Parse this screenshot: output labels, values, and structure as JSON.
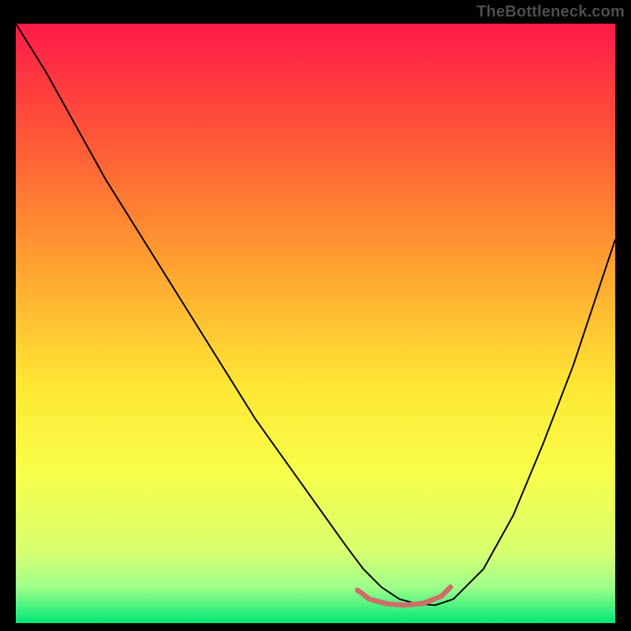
{
  "watermark": "TheBottleneck.com",
  "chart_data": {
    "type": "line",
    "title": "",
    "xlabel": "",
    "ylabel": "",
    "xlim": [
      0,
      100
    ],
    "ylim": [
      0,
      100
    ],
    "grid": false,
    "legend": false,
    "background_gradient": {
      "stops": [
        {
          "offset": 0.0,
          "color": "#ff1a48"
        },
        {
          "offset": 0.2,
          "color": "#ff5a37"
        },
        {
          "offset": 0.4,
          "color": "#ffa030"
        },
        {
          "offset": 0.6,
          "color": "#ffe634"
        },
        {
          "offset": 0.75,
          "color": "#f7ff4a"
        },
        {
          "offset": 0.88,
          "color": "#d8ff70"
        },
        {
          "offset": 0.94,
          "color": "#9fff8a"
        },
        {
          "offset": 1.0,
          "color": "#00e676"
        }
      ]
    },
    "series": [
      {
        "name": "bottleneck-curve",
        "color": "#000000",
        "width": 2.0,
        "x": [
          0,
          5,
          10,
          15,
          20,
          25,
          30,
          35,
          40,
          45,
          50,
          55,
          58,
          61,
          64,
          67,
          70,
          73,
          78,
          83,
          88,
          93,
          97,
          100
        ],
        "y": [
          100,
          92,
          83,
          74,
          66,
          58,
          50,
          42,
          34,
          27,
          20,
          13,
          9,
          6,
          4,
          3.2,
          3.0,
          4.0,
          9,
          18,
          30,
          43,
          55,
          64
        ]
      },
      {
        "name": "optimal-range-marker",
        "color": "#cf6d6a",
        "width": 6.5,
        "cap": "round",
        "x": [
          57,
          59,
          62,
          65,
          68,
          71,
          72.5
        ],
        "y": [
          5.5,
          4.0,
          3.2,
          3.0,
          3.3,
          4.5,
          6.0
        ]
      }
    ],
    "annotations": []
  }
}
